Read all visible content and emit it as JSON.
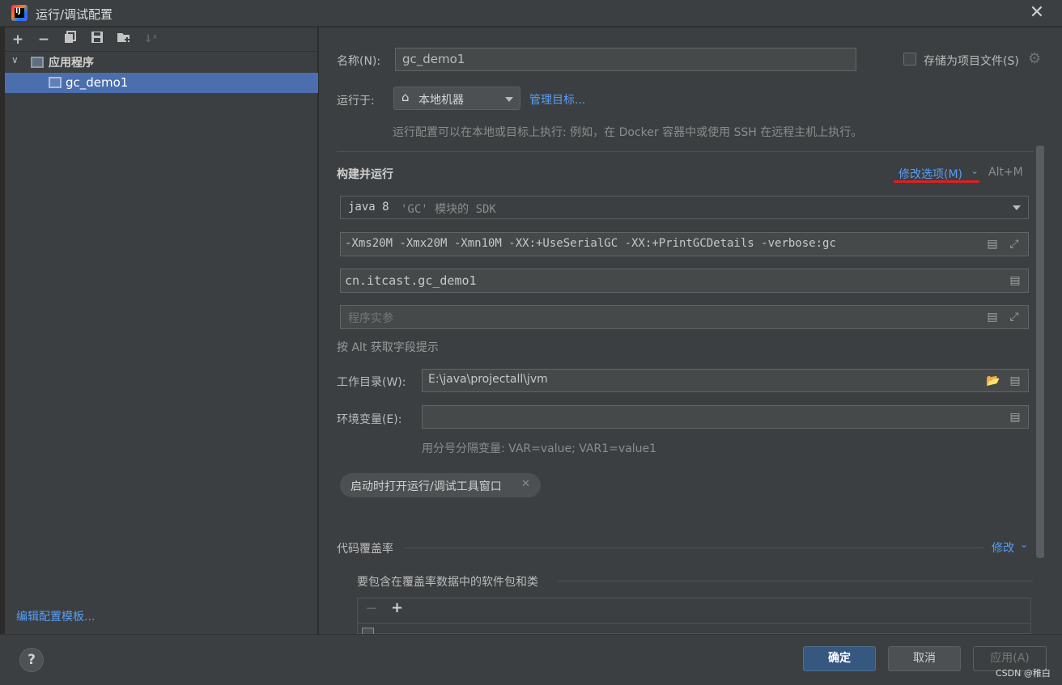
{
  "window": {
    "title": "运行/调试配置"
  },
  "left_panel": {
    "tree": [
      {
        "label": "应用程序"
      },
      {
        "label": "gc_demo1"
      }
    ],
    "edit_templates_link": "编辑配置模板..."
  },
  "form": {
    "name_label": "名称(N):",
    "name_value": "gc_demo1",
    "store_as_project_file_label": "存储为项目文件(S)",
    "run_on_label": "运行于:",
    "run_on_value": "本地机器",
    "manage_targets_link": "管理目标...",
    "run_on_hint": "运行配置可以在本地或目标上执行: 例如，在 Docker 容器中或使用 SSH 在远程主机上执行。",
    "build_and_run_title": "构建并运行",
    "modify_options_link": "修改选项(M)",
    "modify_options_shortcut": "Alt+M",
    "sdk_value": "java 8",
    "sdk_hint": "'GC' 模块的 SDK",
    "vm_options_value": "-Xms20M -Xmx20M -Xmn10M -XX:+UseSerialGC -XX:+PrintGCDetails -verbose:gc",
    "main_class_value": "cn.itcast.gc_demo1",
    "program_args_placeholder": "程序实参",
    "alt_hint": "按 Alt 获取字段提示",
    "working_dir_label": "工作目录(W):",
    "working_dir_value": "E:\\java\\projectall\\jvm",
    "env_vars_label": "环境变量(E):",
    "env_vars_hint": "用分号分隔变量: VAR=value; VAR1=value1",
    "open_tool_window_chip": "启动时打开运行/调试工具窗口",
    "code_coverage_title": "代码覆盖率",
    "code_coverage_modify_link": "修改",
    "coverage_packages_title": "要包含在覆盖率数据中的软件包和类"
  },
  "footer": {
    "help": "?",
    "ok": "确定",
    "cancel": "取消",
    "apply": "应用(A)",
    "watermark": "CSDN @稚白"
  },
  "colors": {
    "accent_link": "#589df6",
    "selection": "#4b6eaf",
    "primary_button": "#365880",
    "annotation_underline": "#e0201d"
  }
}
